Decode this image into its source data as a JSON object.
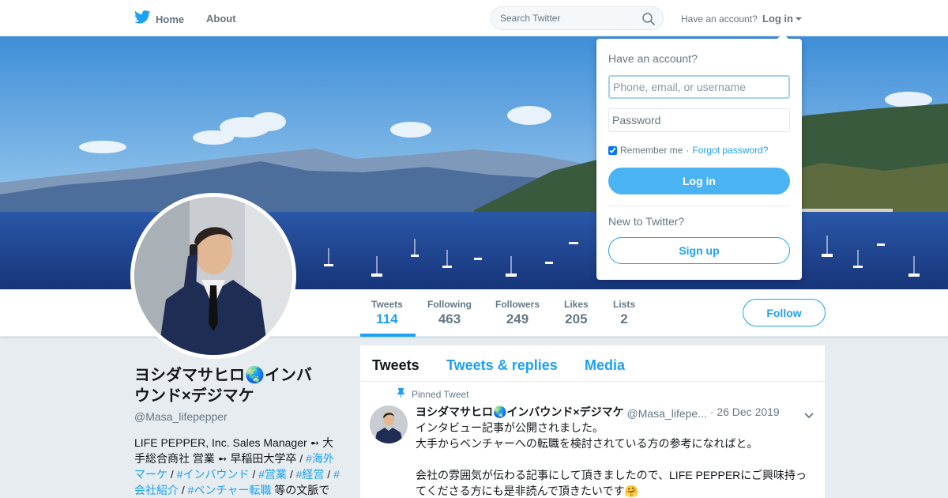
{
  "colors": {
    "brand": "#1da1f2",
    "text": "#14171a",
    "muted": "#657786",
    "background": "#e6ecf0"
  },
  "topbar": {
    "home_label": "Home",
    "home_icon": "twitter-bird-icon",
    "about_label": "About",
    "search_placeholder": "Search Twitter",
    "search_icon": "search-icon",
    "have_account": "Have an account?",
    "login_label": "Log in"
  },
  "profile_nav": {
    "stats": [
      {
        "label": "Tweets",
        "value": "114"
      },
      {
        "label": "Following",
        "value": "463"
      },
      {
        "label": "Followers",
        "value": "249"
      },
      {
        "label": "Likes",
        "value": "205"
      },
      {
        "label": "Lists",
        "value": "2"
      }
    ],
    "follow_label": "Follow"
  },
  "profile": {
    "name_line1": "ヨシダマサヒロ🌏インバ",
    "name_line2": "ウンド×デジマケ",
    "handle": "@Masa_lifepepper",
    "bio": {
      "p1": "LIFE PEPPER, Inc. Sales Manager ➻ 大手総合商社 営業 ➻ 早稲田大学卒 / ",
      "tag1": "#海外マーケ",
      "sep1": " / ",
      "tag2": "#インバウンド",
      "sep2": " / ",
      "tag3": "#営業",
      "sep3": " / ",
      "tag4": "#経営",
      "sep4": " / ",
      "tag5": "#会社紹介",
      "sep5": " / ",
      "tag6": "#ベンチャー転職",
      "p2": " 等の文脈で"
    }
  },
  "timeline": {
    "tabs": [
      "Tweets",
      "Tweets & replies",
      "Media"
    ],
    "pinned_label": "Pinned Tweet",
    "tweet": {
      "name": "ヨシダマサヒロ🌏インバウンド×デジマケ",
      "handle": "@Masa_lifepe...",
      "date": "· 26 Dec 2019",
      "lines": [
        "インタビュー記事が公開されました。",
        "大手からベンチャーへの転職を検討されている方の参考になればと。",
        "",
        "会社の雰囲気が伝わる記事にして頂きましたので、LIFE PEPPERにご興味持ってくださる方にも是非読んで頂きたいです🤗"
      ]
    }
  },
  "login_dropdown": {
    "title": "Have an account?",
    "username_placeholder": "Phone, email, or username",
    "password_placeholder": "Password",
    "remember_label": "Remember me",
    "separator": " · ",
    "forgot_label": "Forgot password?",
    "login_button": "Log in",
    "new_label": "New to Twitter?",
    "signup_button": "Sign up"
  }
}
